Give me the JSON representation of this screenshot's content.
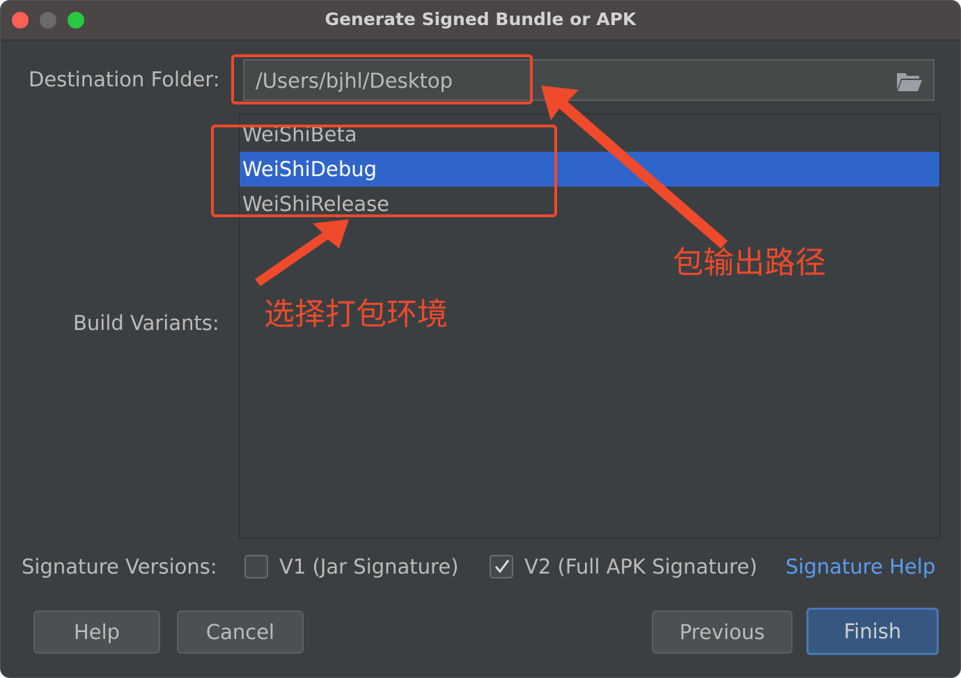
{
  "window": {
    "title": "Generate Signed Bundle or APK"
  },
  "destination": {
    "label": "Destination Folder:",
    "value": "/Users/bjhl/Desktop",
    "icon": "folder-open-icon"
  },
  "build_variants": {
    "label": "Build Variants:",
    "items": [
      {
        "label": "WeiShiBeta",
        "selected": false
      },
      {
        "label": "WeiShiDebug",
        "selected": true
      },
      {
        "label": "WeiShiRelease",
        "selected": false
      }
    ]
  },
  "signature": {
    "label": "Signature Versions:",
    "v1": {
      "label": "V1 (Jar Signature)",
      "checked": false
    },
    "v2": {
      "label": "V2 (Full APK Signature)",
      "checked": true
    },
    "help_link": "Signature Help"
  },
  "buttons": {
    "help": "Help",
    "cancel": "Cancel",
    "previous": "Previous",
    "finish": "Finish"
  },
  "annotations": {
    "output_path": "包输出路径",
    "choose_env": "选择打包环境",
    "color": "#ee4a2b"
  },
  "colors": {
    "background": "#3c3f41",
    "selection": "#2f65ca",
    "link": "#589df6",
    "primary_button": "#365880"
  }
}
